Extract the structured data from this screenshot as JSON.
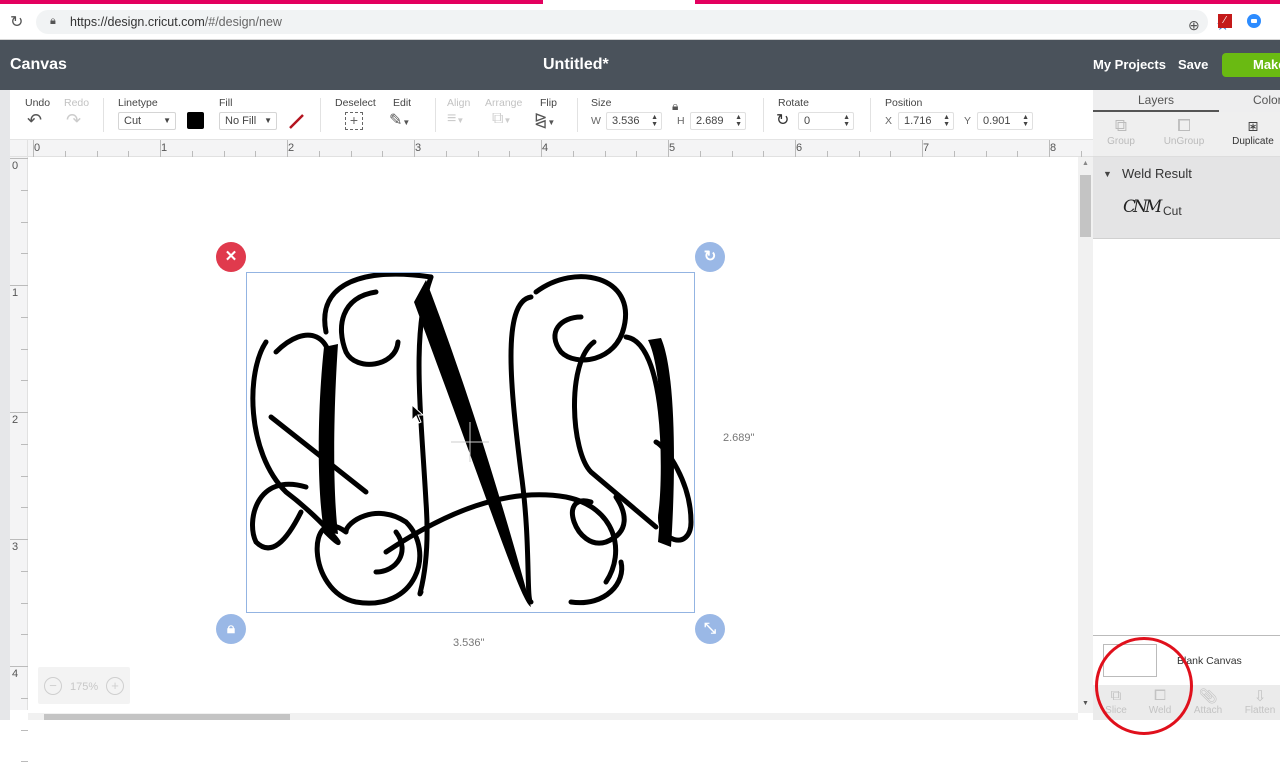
{
  "browser": {
    "url_host": "https://design.cricut.com",
    "url_path": "/#/design/new",
    "icons": [
      "reload-icon",
      "lock-icon",
      "zoom-icon",
      "star-icon",
      "extension-icon",
      "zoom-meeting-icon"
    ]
  },
  "header": {
    "left_title": "Canvas",
    "doc_title": "Untitled*",
    "my_projects": "My Projects",
    "save": "Save",
    "make": "Make It"
  },
  "toolbar": {
    "undo": "Undo",
    "redo": "Redo",
    "linetype_label": "Linetype",
    "linetype_value": "Cut",
    "linetype_color": "#000000",
    "fill_label": "Fill",
    "fill_value": "No Fill",
    "deselect": "Deselect",
    "edit": "Edit",
    "align": "Align",
    "arrange": "Arrange",
    "flip": "Flip",
    "size_label": "Size",
    "w_label": "W",
    "w_value": "3.536",
    "h_label": "H",
    "h_value": "2.689",
    "rotate_label": "Rotate",
    "rotate_value": "0",
    "position_label": "Position",
    "x_label": "X",
    "x_value": "1.716",
    "y_label": "Y",
    "y_value": "0.901"
  },
  "rulers": {
    "horizontal": [
      "0",
      "1",
      "2",
      "3",
      "4",
      "5",
      "6",
      "7",
      "8"
    ],
    "vertical": [
      "0",
      "1",
      "2",
      "3",
      "4"
    ]
  },
  "canvas": {
    "selection_height_label": "2.689\"",
    "selection_width_label": "3.536\"",
    "zoom_level": "175%",
    "zoom_out": "−",
    "zoom_in": "+"
  },
  "panel": {
    "tabs": [
      "Layers",
      "Color Sync"
    ],
    "layer_tools": [
      {
        "label": "Group",
        "enabled": false
      },
      {
        "label": "UnGroup",
        "enabled": false
      },
      {
        "label": "Duplicate",
        "enabled": true
      }
    ],
    "group_name": "Weld Result",
    "layer_thumb": "CNM",
    "layer_type": "Cut",
    "blank_canvas": "Blank Canvas",
    "bottom_tools": [
      "Slice",
      "Weld",
      "Attach",
      "Flatten"
    ]
  }
}
